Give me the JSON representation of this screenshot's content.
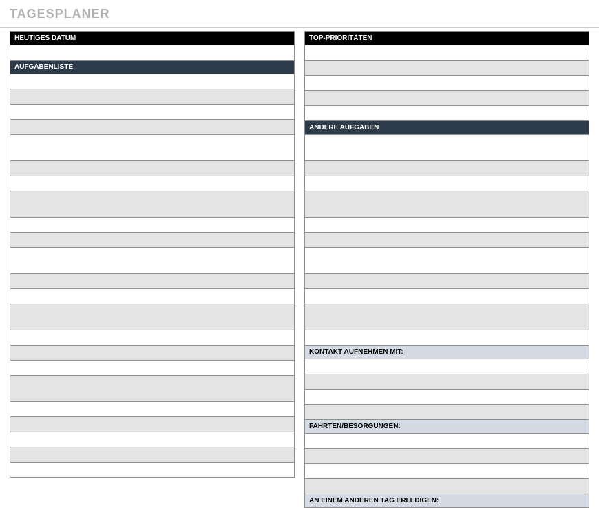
{
  "title": "TAGESPLANER",
  "left": {
    "date_header": "HEUTIGES DATUM",
    "tasks_header": "AUFGABENLISTE"
  },
  "right": {
    "priorities_header": "TOP-PRIORITÄTEN",
    "other_tasks_header": "ANDERE AUFGABEN",
    "contact_header": "KONTAKT AUFNEHMEN MIT:",
    "errands_header": "FAHRTEN/BESORGUNGEN:",
    "later_header": "AN EINEM ANDEREN TAG ERLEDIGEN:"
  }
}
